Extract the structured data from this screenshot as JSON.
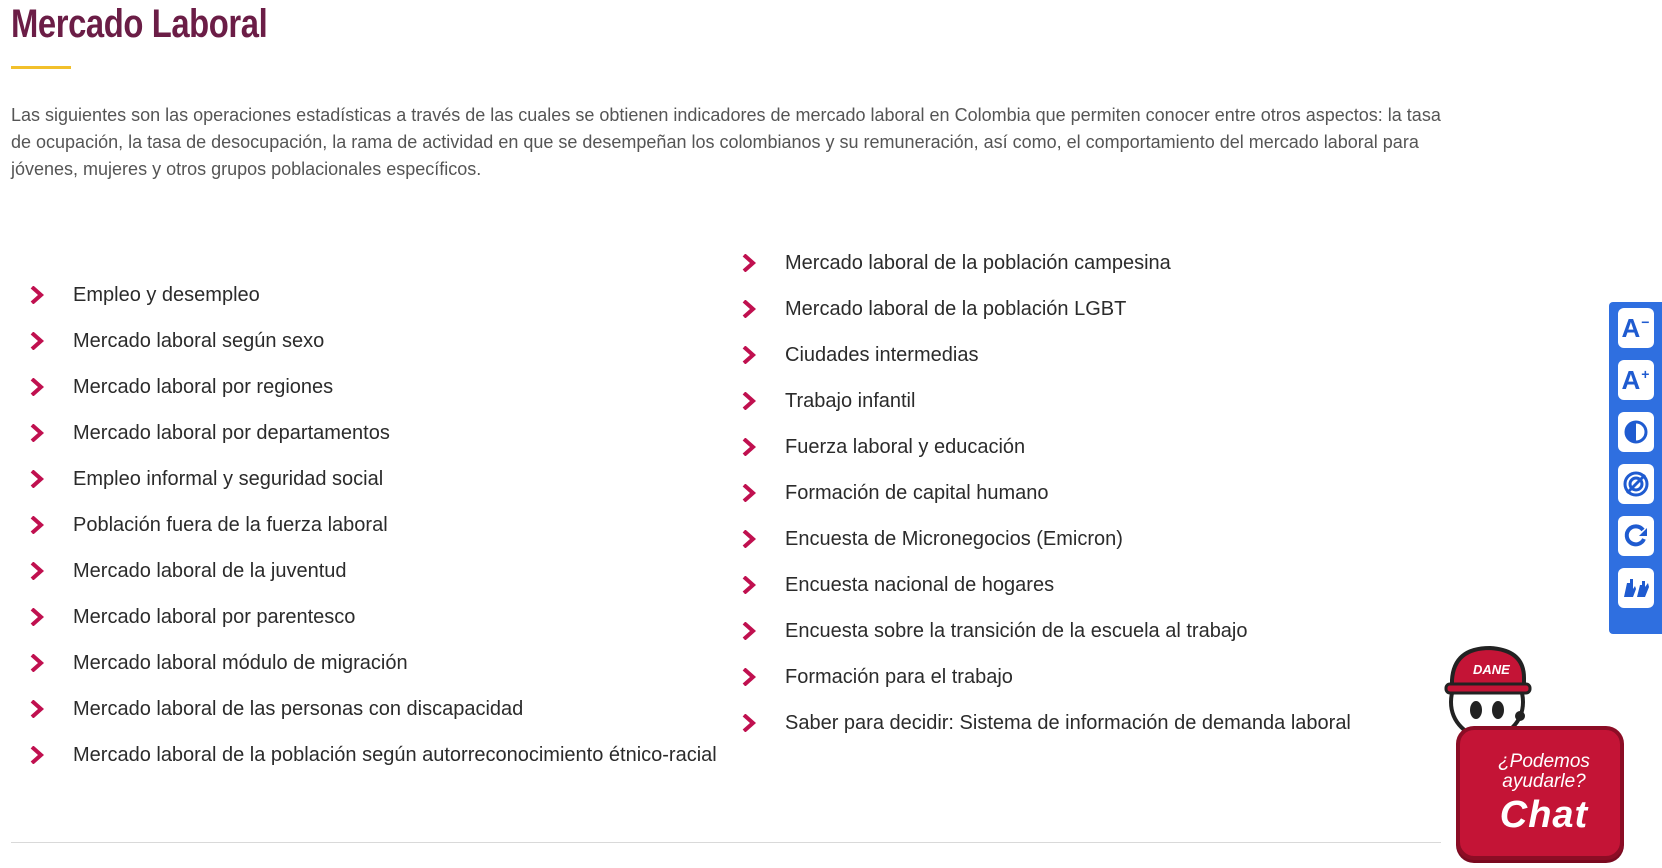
{
  "page": {
    "title": "Mercado Laboral",
    "intro": "Las siguientes son las operaciones estadísticas a través de las cuales se obtienen indicadores de mercado laboral en Colombia que permiten conocer entre otros aspectos: la tasa de ocupación, la tasa de desocupación, la rama de actividad en que se desempeñan los colombianos y su remuneración, así como, el comportamiento del mercado laboral para jóvenes, mujeres y otros grupos poblacionales específicos."
  },
  "links_left": [
    "Empleo y desempleo",
    "Mercado laboral según sexo",
    "Mercado laboral por regiones",
    "Mercado laboral por departamentos",
    "Empleo informal y seguridad social",
    "Población fuera de la fuerza laboral",
    "Mercado laboral de la juventud",
    "Mercado laboral por parentesco",
    "Mercado laboral módulo de migración",
    "Mercado laboral de las personas con discapacidad",
    "Mercado laboral de la población según autorreconocimiento étnico-racial"
  ],
  "links_right": [
    "Mercado laboral de la población campesina",
    "Mercado laboral de la población LGBT",
    "Ciudades intermedias",
    "Trabajo infantil",
    "Fuerza laboral y educación",
    "Formación de capital humano",
    "Encuesta de Micronegocios (Emicron)",
    "Encuesta nacional de hogares",
    "Encuesta sobre la transición de la escuela al trabajo",
    "Formación para el trabajo",
    "Saber para decidir: Sistema de información de demanda laboral"
  ],
  "accessibility": {
    "decrease_label": "A",
    "increase_label": "A",
    "decrease_mark": "−",
    "increase_mark": "+",
    "icons": [
      "text-decrease-icon",
      "text-increase-icon",
      "contrast-icon",
      "grayscale-icon",
      "reset-icon",
      "sign-language-icon"
    ]
  },
  "chat": {
    "prompt": "¿Podemos ayudarle?",
    "label": "Chat",
    "mascot_badge": "DANE"
  },
  "colors": {
    "title": "#6b1d46",
    "accent_underline": "#f2c02b",
    "chevron": "#c0104f",
    "a11y_bar": "#2f6fe0",
    "chat_red": "#c41436"
  }
}
